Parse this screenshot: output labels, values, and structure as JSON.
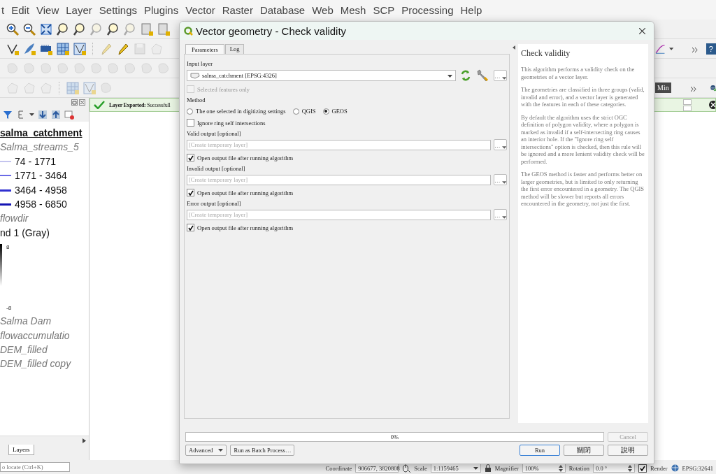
{
  "menu_bar": {
    "items": [
      "t",
      "Edit",
      "View",
      "Layer",
      "Settings",
      "Plugins",
      "Vector",
      "Raster",
      "Database",
      "Web",
      "Mesh",
      "SCP",
      "Processing",
      "Help"
    ]
  },
  "toolbar": {
    "help_button": "?",
    "min_button": "Min"
  },
  "layers_panel": {
    "layers": [
      {
        "name": "salma_catchment",
        "kind": "current"
      },
      {
        "name": "Salma_streams_5",
        "kind": "hidden",
        "children": [
          {
            "kind": "line",
            "label": "74 - 1771",
            "color": "#c4c4ee"
          },
          {
            "kind": "line",
            "label": "1771 - 3464",
            "color": "#6a6ae6"
          },
          {
            "kind": "line",
            "label": "3464 - 4958",
            "color": "#3030d0"
          },
          {
            "kind": "line",
            "label": "4958 - 6850",
            "color": "#1414b4"
          }
        ]
      },
      {
        "name": "flowdir",
        "kind": "hidden",
        "children": [
          {
            "kind": "band",
            "label": "nd 1 (Gray)"
          },
          {
            "kind": "ramp",
            "max": "8",
            "min": "-8"
          }
        ]
      },
      {
        "name": "Salma Dam",
        "kind": "hidden"
      },
      {
        "name": "flowaccumulatio",
        "kind": "hidden"
      },
      {
        "name": "DEM_filled",
        "kind": "hidden"
      },
      {
        "name": "DEM_filled copy",
        "kind": "hidden"
      }
    ],
    "tabs": [
      {
        "label": "Layers",
        "selected": true
      }
    ]
  },
  "message_bar": {
    "message": "**Layer Exported:** Successfull"
  },
  "dialog": {
    "title": "Vector geometry - Check validity",
    "tabs": [
      {
        "label": "Parameters",
        "selected": true
      },
      {
        "label": "Log",
        "selected": false
      }
    ],
    "parameters": [
      {
        "kind": "layer_select",
        "label": "Input layer",
        "value": "salma_catchment [EPSG:4326]",
        "button": "…"
      },
      {
        "kind": "checkbox",
        "label": "Selected features only",
        "checked": false,
        "disabled": true
      },
      {
        "kind": "radio",
        "label": "Method",
        "options": [
          {
            "label": "The one selected in digitizing settings",
            "selected": false
          },
          {
            "label": "QGIS",
            "selected": false
          },
          {
            "label": "GEOS",
            "selected": true
          }
        ]
      },
      {
        "kind": "checkbox",
        "label": "Ignore ring self intersections",
        "checked": false,
        "disabled": false
      },
      {
        "kind": "output",
        "label": "Valid output [optional]",
        "placeholder": "[Create temporary layer]",
        "button": "…"
      },
      {
        "kind": "checkbox",
        "label": "Open output file after running algorithm",
        "checked": true,
        "disabled": false
      },
      {
        "kind": "output",
        "label": "Invalid output [optional]",
        "placeholder": "[Create temporary layer]",
        "button": "…"
      },
      {
        "kind": "checkbox",
        "label": "Open output file after running algorithm",
        "checked": true,
        "disabled": false
      },
      {
        "kind": "output",
        "label": "Error output [optional]",
        "placeholder": "[Create temporary layer]",
        "button": "…"
      },
      {
        "kind": "checkbox",
        "label": "Open output file after running algorithm",
        "checked": true,
        "disabled": false
      }
    ],
    "help": {
      "title": "Check validity",
      "paragraphs": [
        "This algorithm performs a validity check on the geometries of a vector layer.",
        "The geometries are classified in three groups (valid, invalid and error), and a vector layer is generated with the features in each of these categories.",
        "By default the algorithm uses the strict OGC definition of polygon validity, where a polygon is marked as invalid if a self-intersecting ring causes an interior hole. If the \"Ignore ring self intersections\" option is checked, then this rule will be ignored and a more lenient validity check will be performed.",
        "The GEOS method is faster and performs better on larger geometries, but is limited to only returning the first error encountered in a geometry. The QGIS method will be slower but reports all errors encountered in the geometry, not just the first."
      ]
    },
    "progress": {
      "level": 0,
      "text": "0%"
    },
    "cancel_button": {
      "label": "Cancel",
      "disabled": true
    },
    "left_buttons": [
      {
        "label": "Advanced",
        "kind": "dropdown"
      },
      {
        "label": "Run as Batch Process…",
        "kind": "plain"
      }
    ],
    "right_buttons": [
      {
        "label": "Run",
        "kind": "default"
      },
      {
        "label": "關閉",
        "kind": "plain"
      },
      {
        "label": "說明",
        "kind": "plain"
      }
    ]
  },
  "status_bar": {
    "locator_placeholder": "o locate (Ctrl+K)",
    "coordinate_label": "Coordinate",
    "coordinate": "906677, 3820808",
    "scale_label": "Scale",
    "scale": "1:1159465",
    "magnifier_label": "Magnifier",
    "magnifier": "100%",
    "rotation_label": "Rotation",
    "rotation": "0.0 °",
    "render": {
      "label": "Render",
      "checked": true
    },
    "crs": "EPSG:32641"
  }
}
